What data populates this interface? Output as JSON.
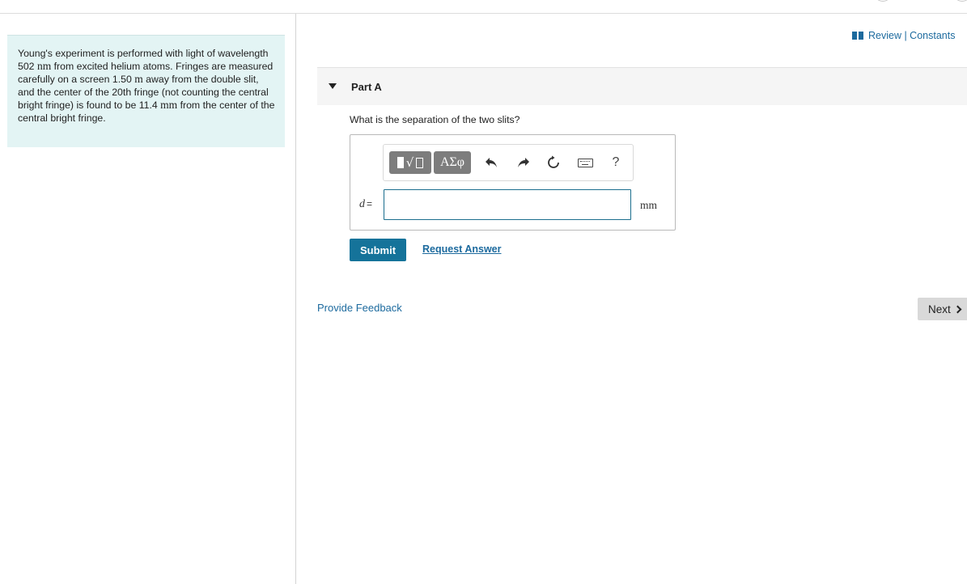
{
  "problem": {
    "text_1": "Young's experiment is performed with light of wavelength 502 ",
    "unit_1": "nm",
    "text_2": " from excited helium atoms. Fringes are measured carefully on a screen 1.50 ",
    "unit_2": "m",
    "text_3": " away from the double slit, and the center of the 20th fringe (not counting the central bright fringe) is found to be 11.4 ",
    "unit_3": "mm",
    "text_4": " from the center of the central bright fringe."
  },
  "header": {
    "review_constants": "Review | Constants"
  },
  "part": {
    "title": "Part A",
    "question": "What is the separation of the two slits?"
  },
  "toolbar": {
    "greek_label": "ΑΣφ",
    "help_label": "?"
  },
  "answer": {
    "variable": "d",
    "equals": "=",
    "value": "",
    "unit": "mm"
  },
  "actions": {
    "submit": "Submit",
    "request_answer": "Request Answer",
    "provide_feedback": "Provide Feedback",
    "next": "Next"
  }
}
